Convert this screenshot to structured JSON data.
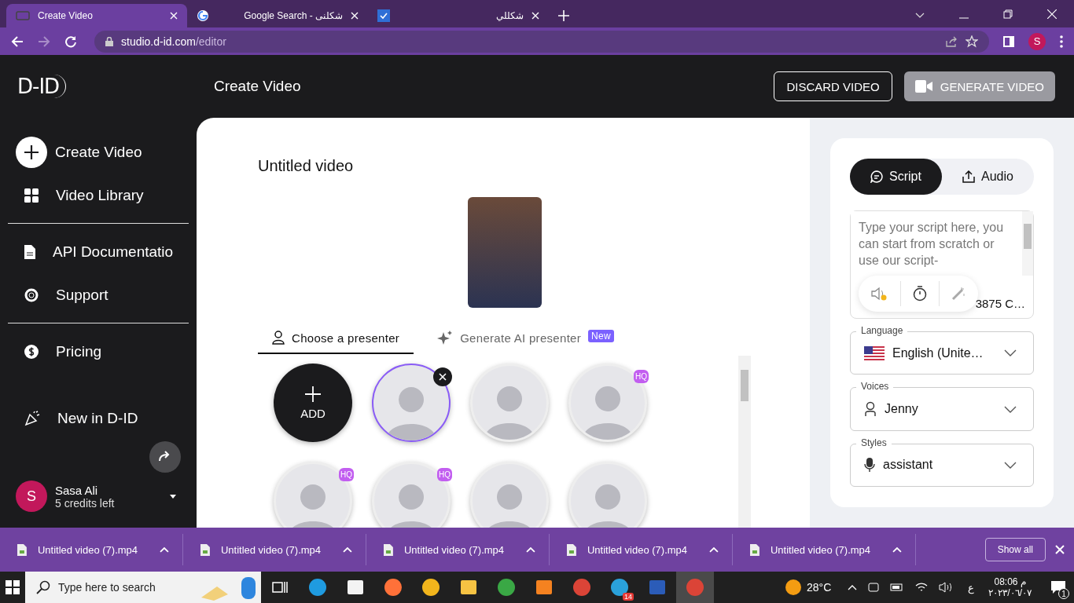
{
  "browser": {
    "tabs": [
      {
        "title": "Create Video",
        "selected": true
      },
      {
        "title": "Google Search - شكلنى",
        "selected": false
      },
      {
        "title": "شكللي",
        "selected": false
      }
    ],
    "url": {
      "host": "studio.d-id.com",
      "path": "/editor"
    },
    "profile_initial": "S"
  },
  "header": {
    "logo": "D-ID",
    "title": "Create Video",
    "discard": "DISCARD VIDEO",
    "generate": {
      "label": "GENERATE VIDEO",
      "disabled": true
    }
  },
  "sidebar": {
    "groups": [
      [
        {
          "label": "Create Video"
        },
        {
          "label": "Video Library"
        }
      ],
      [
        {
          "label": "API Documentatio"
        },
        {
          "label": "Support"
        }
      ],
      [
        {
          "label": "Pricing"
        },
        {
          "label": "New in D-ID"
        }
      ]
    ],
    "user": {
      "initial": "S",
      "name": "Sasa Ali",
      "credits": "5 credits left"
    }
  },
  "editor": {
    "title": "Untitled video",
    "presenter_tabs": [
      {
        "label": "Choose a presenter",
        "selected": true
      },
      {
        "label": "Generate AI presenter",
        "selected": false,
        "badge": "New"
      }
    ],
    "presenters": [
      {
        "kind": "add",
        "label": "ADD"
      },
      {
        "kind": "photo",
        "selected": true,
        "removable": true
      },
      {
        "kind": "photo",
        "selected": false
      },
      {
        "kind": "photo",
        "selected": false,
        "badge": "HQ"
      },
      {
        "kind": "photo",
        "selected": false,
        "badge": "HQ"
      },
      {
        "kind": "photo",
        "selected": false,
        "badge": "HQ"
      },
      {
        "kind": "photo",
        "selected": false
      },
      {
        "kind": "photo",
        "selected": false
      }
    ]
  },
  "panel": {
    "modes": [
      {
        "label": "Script",
        "selected": true
      },
      {
        "label": "Audio",
        "selected": false
      }
    ],
    "script": {
      "placeholder": "Type your script here, you can start from scratch or use our script-",
      "count": "3875 C…"
    },
    "fields": [
      {
        "label": "Language",
        "value": "English (Unite…"
      },
      {
        "label": "Voices",
        "value": "Jenny"
      },
      {
        "label": "Styles",
        "value": "assistant"
      }
    ]
  },
  "downloads": {
    "items": [
      {
        "name": "Untitled video (7).mp4"
      },
      {
        "name": "Untitled video (7).mp4"
      },
      {
        "name": "Untitled video (7).mp4"
      },
      {
        "name": "Untitled video (7).mp4"
      },
      {
        "name": "Untitled video (7).mp4"
      }
    ],
    "show_all": "Show all"
  },
  "taskbar": {
    "search": "Type here to search",
    "apps": [
      {
        "kind": "taskview",
        "selected": false
      },
      {
        "kind": "edge",
        "selected": false
      },
      {
        "kind": "store",
        "selected": false
      },
      {
        "kind": "firefox",
        "selected": false
      },
      {
        "kind": "aimp",
        "selected": false
      },
      {
        "kind": "folder",
        "selected": false
      },
      {
        "kind": "idm",
        "selected": false
      },
      {
        "kind": "foxit",
        "selected": false
      },
      {
        "kind": "chrome",
        "selected": false
      },
      {
        "kind": "telegram",
        "selected": false,
        "badge": "14"
      },
      {
        "kind": "word",
        "selected": false
      },
      {
        "kind": "chrome",
        "selected": true
      }
    ],
    "weather": "28°C",
    "lang": "ع",
    "time": "08:06 م",
    "date": "٢٠٢٣/٠٦/٠٧",
    "notifications": "1"
  }
}
